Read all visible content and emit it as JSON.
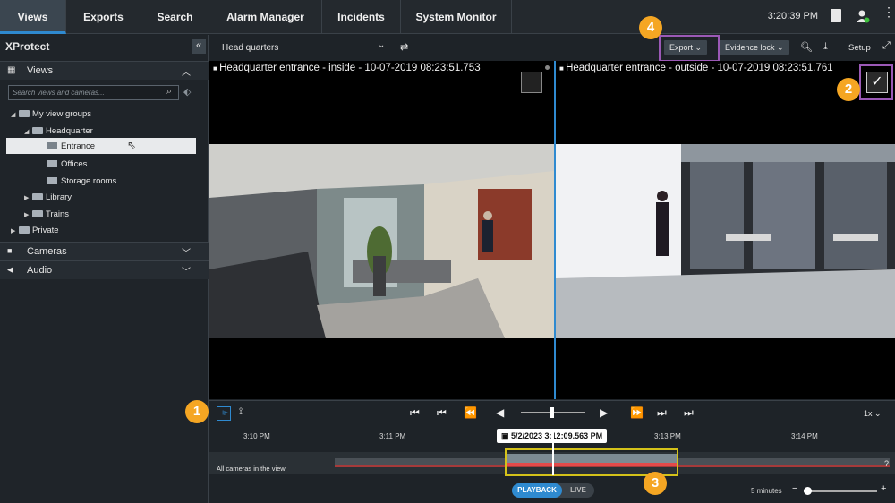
{
  "nav": {
    "tabs": [
      "Views",
      "Exports",
      "Search",
      "Alarm Manager",
      "Incidents",
      "System Monitor"
    ],
    "active_tab": "Views",
    "clock": "3:20:39 PM"
  },
  "sidebar": {
    "app_title": "XProtect",
    "views_label": "Views",
    "search_placeholder": "Search views and cameras...",
    "tree": {
      "my_view_groups": "My view groups",
      "headquarter": "Headquarter",
      "entrance": "Entrance",
      "offices": "Offices",
      "storage_rooms": "Storage rooms",
      "library": "Library",
      "trains": "Trains",
      "private": "Private"
    },
    "cameras_label": "Cameras",
    "audio_label": "Audio"
  },
  "toolbar": {
    "view_select": "Head quarters",
    "export_label": "Export",
    "evidence_lock_label": "Evidence lock",
    "setup_label": "Setup"
  },
  "cameras": [
    {
      "title": "Headquarter entrance - inside - 10-07-2019 08:23:51.753"
    },
    {
      "title": "Headquarter entrance - outside - 10-07-2019 08:23:51.761"
    }
  ],
  "playback": {
    "speed": "1x",
    "time_ticks": [
      "3:10 PM",
      "3:11 PM",
      "3:13 PM",
      "3:14 PM"
    ],
    "current_time": "5/2/2023 3:12:09.563 PM",
    "track_label": "All cameras in the view",
    "mode_playback": "PLAYBACK",
    "mode_live": "LIVE",
    "zoom_label": "5 minutes",
    "help": "?"
  },
  "callouts": [
    "1",
    "2",
    "3",
    "4"
  ],
  "colors": {
    "accent": "#2f8ad0",
    "callout": "#f5a623",
    "highlight_purple": "#9b59b6",
    "timeline_selection": "#d4c21a"
  }
}
